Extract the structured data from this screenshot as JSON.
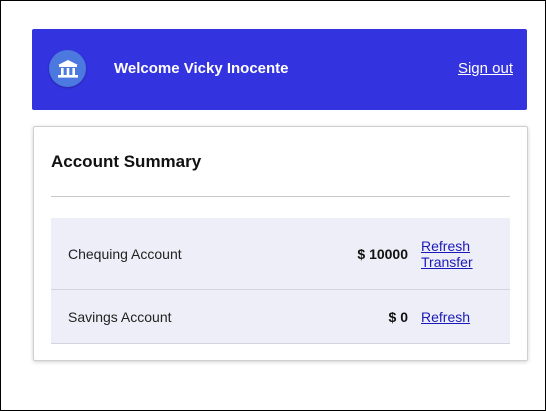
{
  "header": {
    "welcome_text": "Welcome Vicky Inocente",
    "sign_out_label": "Sign out",
    "logo_icon": "bank-icon"
  },
  "summary": {
    "title": "Account Summary",
    "accounts": [
      {
        "name": "Chequing Account",
        "balance": "$ 10000",
        "refresh_label": "Refresh",
        "transfer_label": "Transfer"
      },
      {
        "name": "Savings Account",
        "balance": "$ 0",
        "refresh_label": "Refresh"
      }
    ]
  },
  "colors": {
    "header_bg": "#3333e0",
    "logo_circle": "#4c79df",
    "link": "#1a1ab8",
    "row_bg": "#eeeef8"
  }
}
